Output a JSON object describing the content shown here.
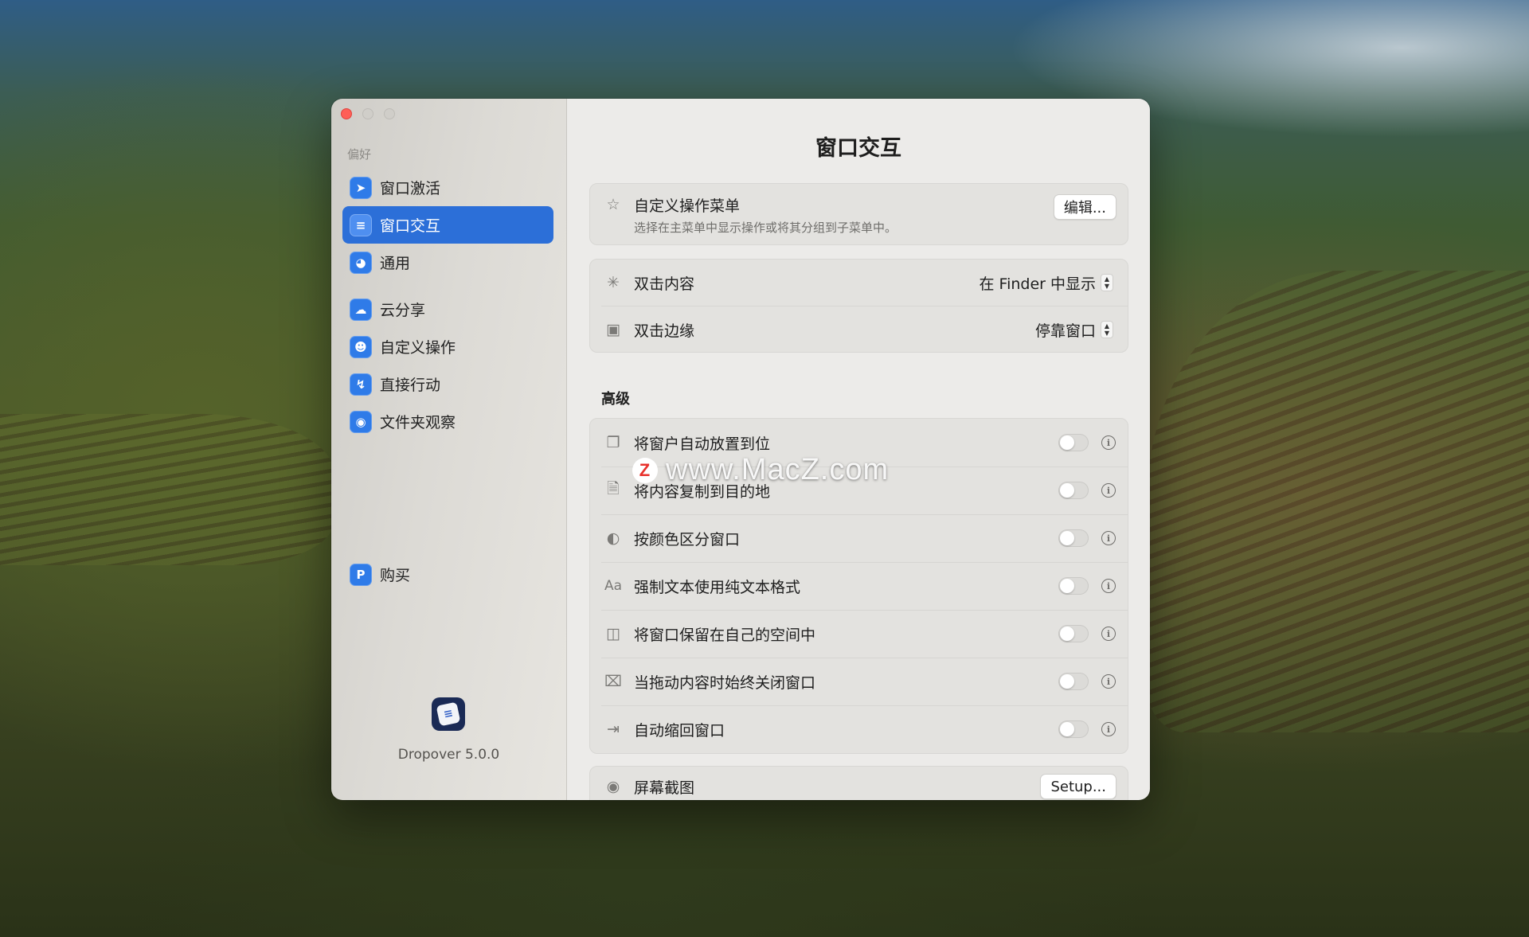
{
  "sidebar": {
    "section_label": "偏好",
    "items": [
      {
        "label": "窗口激活",
        "icon": "cursor-arrow-icon",
        "active": false
      },
      {
        "label": "窗口交互",
        "icon": "sliders-icon",
        "active": true
      },
      {
        "label": "通用",
        "icon": "gauge-icon",
        "active": false
      },
      {
        "label": "云分享",
        "icon": "cloud-icon",
        "active": false
      },
      {
        "label": "自定义操作",
        "icon": "person-icon",
        "active": false
      },
      {
        "label": "直接行动",
        "icon": "bolt-icon",
        "active": false
      },
      {
        "label": "文件夹观察",
        "icon": "folder-eye-icon",
        "active": false
      },
      {
        "label": "购买",
        "icon": "purchase-icon",
        "active": false
      }
    ],
    "app_version": "Dropover 5.0.0"
  },
  "main": {
    "title": "窗口交互",
    "custom_menu": {
      "label": "自定义操作菜单",
      "description": "选择在主菜单中显示操作或将其分组到子菜单中。",
      "button": "编辑..."
    },
    "double_click_content": {
      "label": "双击内容",
      "value": "在 Finder 中显示"
    },
    "double_click_edge": {
      "label": "双击边缘",
      "value": "停靠窗口"
    },
    "advanced_label": "高级",
    "advanced": [
      {
        "label": "将窗户自动放置到位",
        "icon": "windows-stack-icon",
        "enabled": false
      },
      {
        "label": "将内容复制到目的地",
        "icon": "doc-copy-icon",
        "enabled": false
      },
      {
        "label": "按颜色区分窗口",
        "icon": "palette-icon",
        "enabled": false
      },
      {
        "label": "强制文本使用纯文本格式",
        "icon": "text-format-icon",
        "enabled": false
      },
      {
        "label": "将窗口保留在自己的空间中",
        "icon": "spaces-icon",
        "enabled": false
      },
      {
        "label": "当拖动内容时始终关闭窗口",
        "icon": "close-box-icon",
        "enabled": false
      },
      {
        "label": "自动缩回窗口",
        "icon": "retract-icon",
        "enabled": false
      }
    ],
    "screenshot": {
      "label": "屏幕截图",
      "button": "Setup..."
    }
  },
  "watermark": {
    "text": "www.MacZ.com",
    "logo_letter": "Z"
  },
  "colors": {
    "accent": "#2c6fd8",
    "close": "#fe5f57",
    "icon_blue": "#2f7be8"
  }
}
